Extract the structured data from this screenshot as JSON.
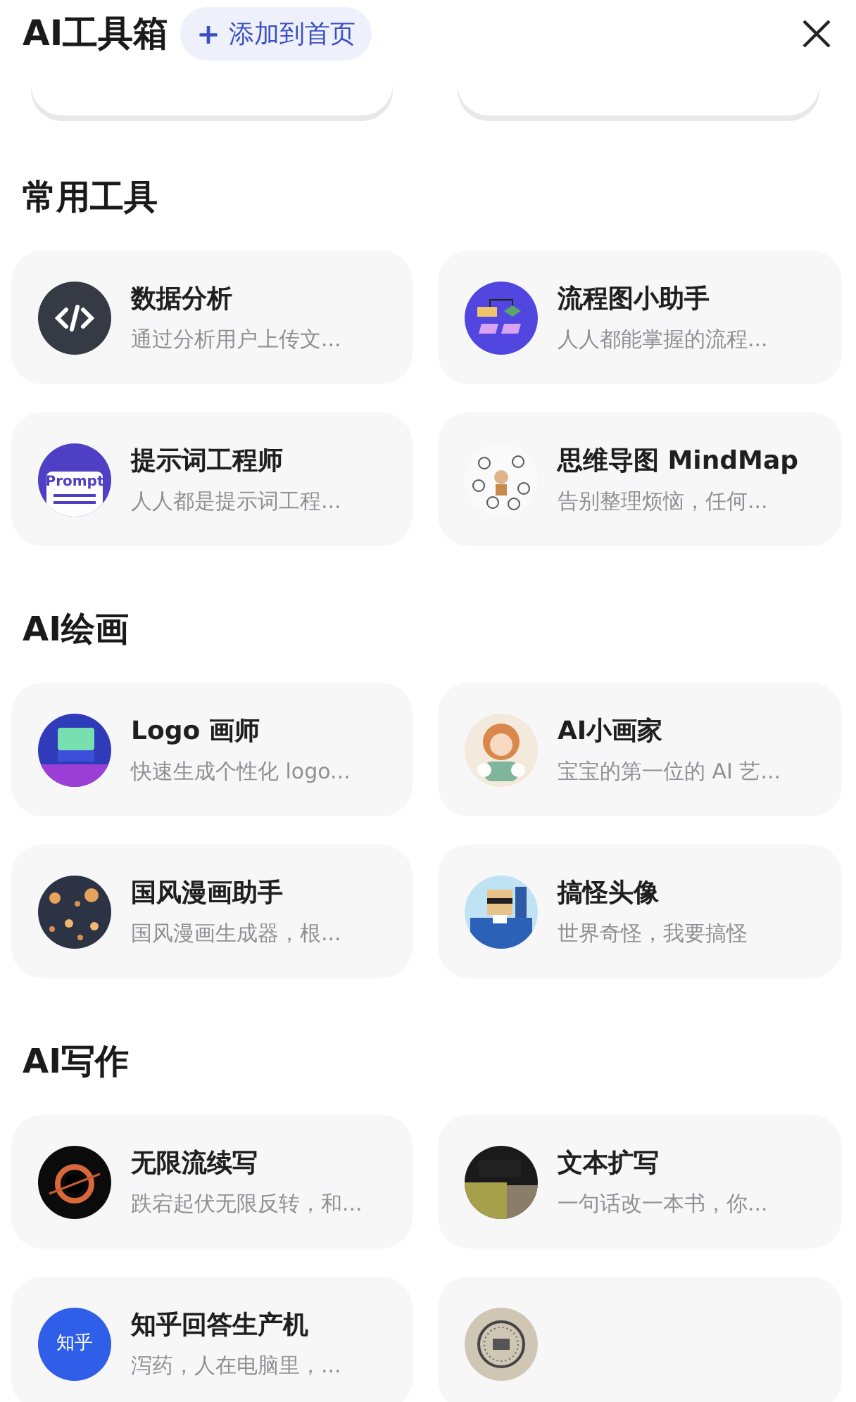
{
  "header": {
    "title": "AI工具箱",
    "add_button": {
      "icon": "+",
      "label": "添加到首页"
    }
  },
  "sections": [
    {
      "title": "常用工具",
      "tools": [
        {
          "kind": "code",
          "name": "数据分析",
          "desc": "通过分析用户上传文..."
        },
        {
          "kind": "flow",
          "name": "流程图小助手",
          "desc": "人人都能掌握的流程..."
        },
        {
          "kind": "prompt",
          "icon_text": "Prompt",
          "name": "提示词工程师",
          "desc": "人人都是提示词工程..."
        },
        {
          "kind": "mindmap",
          "name": "思维导图 MindMap",
          "desc": "告别整理烦恼，任何..."
        }
      ]
    },
    {
      "title": "AI绘画",
      "tools": [
        {
          "kind": "logo",
          "name": "Logo 画师",
          "desc": "快速生成个性化 logo..."
        },
        {
          "kind": "girl",
          "name": "AI小画家",
          "desc": "宝宝的第一位的 AI 艺..."
        },
        {
          "kind": "lanterns",
          "name": "国风漫画助手",
          "desc": "国风漫画生成器，根..."
        },
        {
          "kind": "pixel",
          "name": "搞怪头像",
          "desc": "世界奇怪，我要搞怪"
        }
      ]
    },
    {
      "title": "AI写作",
      "tools": [
        {
          "kind": "blackhole",
          "name": "无限流续写",
          "desc": "跌宕起伏无限反转，和..."
        },
        {
          "kind": "abstract",
          "name": "文本扩写",
          "desc": "一句话改一本书，你..."
        },
        {
          "kind": "zhihu",
          "icon_text": "知乎",
          "name": "知乎回答生产机",
          "desc": "泻药，人在电脑里，..."
        },
        {
          "kind": "seal"
        }
      ]
    }
  ]
}
